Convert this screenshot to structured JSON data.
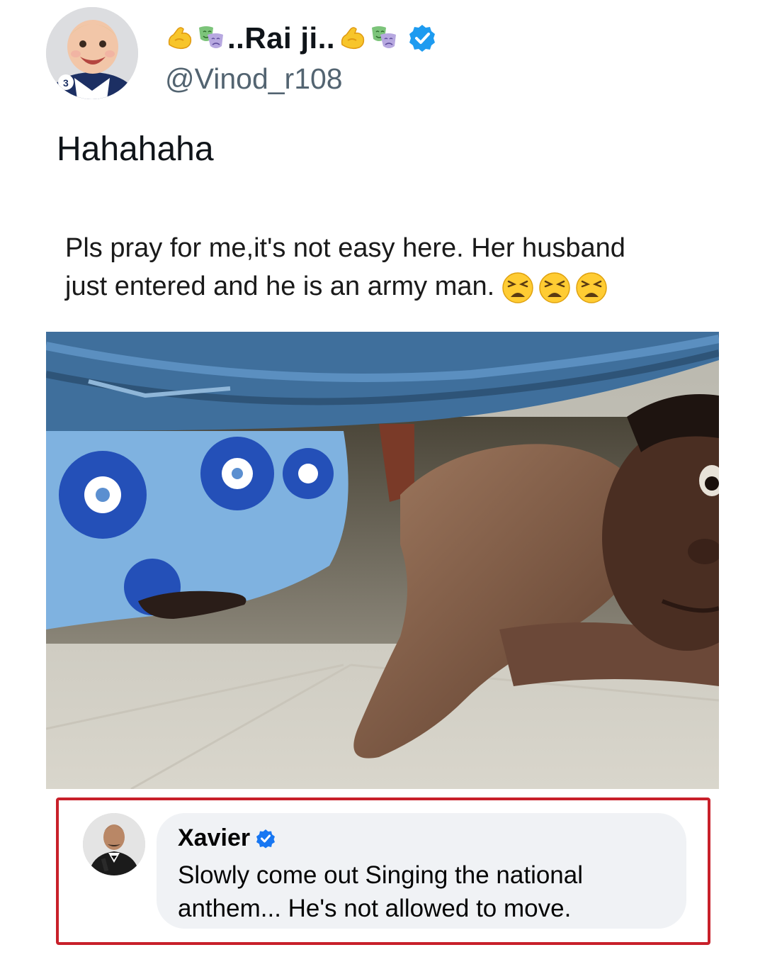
{
  "tweet": {
    "author": {
      "display_name": "..Rai ji..",
      "handle": "@Vinod_r108",
      "verified": true,
      "name_emojis": [
        "flexed-biceps",
        "performing-arts"
      ],
      "avatar": "baby-avatar"
    },
    "text": "Hahahaha"
  },
  "meme": {
    "caption_line_1": "Pls pray for me,it's not easy here. Her husband",
    "caption_line_2": "just entered and he is an army man.",
    "caption_emojis": [
      "weary-face",
      "weary-face",
      "weary-face"
    ],
    "photo": "man-hiding-under-bed-photo",
    "reply": {
      "author": "Xavier",
      "verified": true,
      "avatar": "man-in-suit-avatar",
      "text_line_1": "Slowly come out Singing the national",
      "text_line_2": "anthem... He's not allowed to move."
    }
  },
  "colors": {
    "verified_blue": "#1d9bf0",
    "reply_highlight_border": "#c8202a",
    "reply_bubble_bg": "#f0f2f5",
    "handle_gray": "#536471"
  }
}
